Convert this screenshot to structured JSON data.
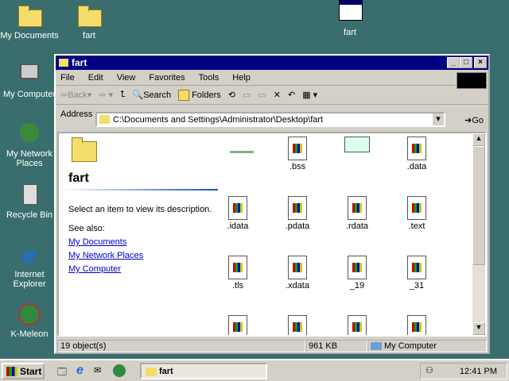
{
  "desktop": {
    "icons": [
      "My Documents",
      "fart",
      "fart",
      "My Computer",
      "My Network Places",
      "Recycle Bin",
      "Internet Explorer",
      "K-Meleon"
    ]
  },
  "window": {
    "title": "fart",
    "menus": [
      "File",
      "Edit",
      "View",
      "Favorites",
      "Tools",
      "Help"
    ],
    "toolbar": {
      "back": "Back",
      "search": "Search",
      "folders": "Folders"
    },
    "address": {
      "label": "Address",
      "value": "C:\\Documents and Settings\\Administrator\\Desktop\\fart",
      "go": "Go"
    },
    "left": {
      "heading": "fart",
      "prompt": "Select an item to view its description.",
      "see_also": "See also:",
      "links": [
        "My Documents",
        "My Network Places",
        "My Computer"
      ]
    },
    "files": [
      ".bss",
      ".data",
      ".idata",
      ".pdata",
      ".rdata",
      ".text",
      ".tls",
      ".xdata",
      "_19",
      "_31"
    ],
    "status": {
      "objects": "19 object(s)",
      "size": "961 KB",
      "zone": "My Computer"
    }
  },
  "taskbar": {
    "start": "Start",
    "task": "fart",
    "clock": "12:41 PM"
  }
}
